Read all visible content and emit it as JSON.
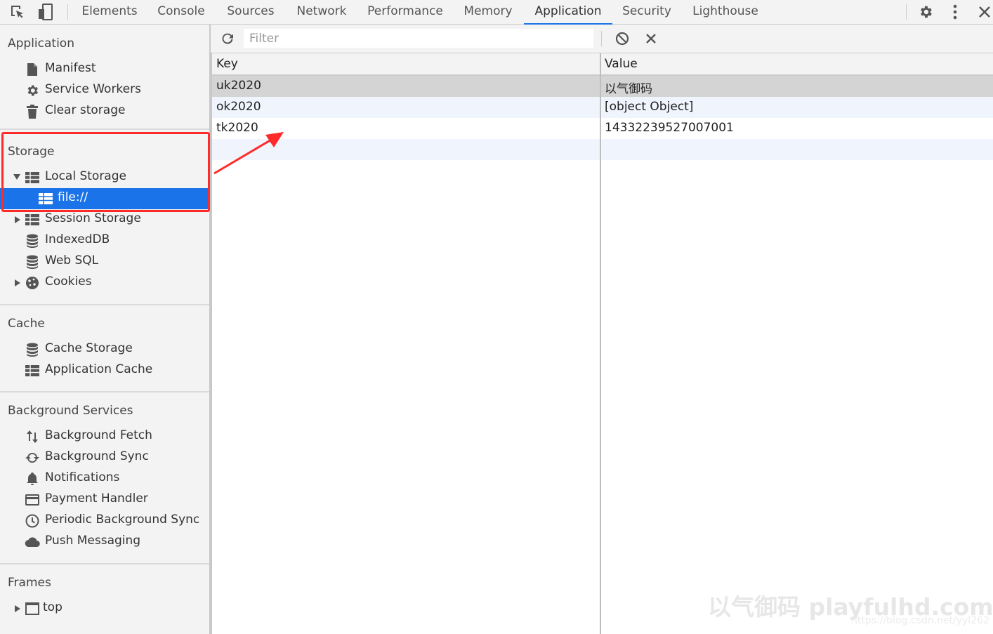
{
  "tabs": [
    "Elements",
    "Console",
    "Sources",
    "Network",
    "Performance",
    "Memory",
    "Application",
    "Security",
    "Lighthouse"
  ],
  "active_tab": "Application",
  "icons": {
    "inspect": "inspect-element-icon",
    "device": "device-toolbar-icon",
    "settings": "gear-icon",
    "more": "kebab-menu-icon",
    "close": "close-icon"
  },
  "sidebar": {
    "application": {
      "title": "Application",
      "items": [
        "Manifest",
        "Service Workers",
        "Clear storage"
      ]
    },
    "storage": {
      "title": "Storage",
      "local_storage": "Local Storage",
      "local_storage_child": "file://",
      "items": [
        "Session Storage",
        "IndexedDB",
        "Web SQL",
        "Cookies"
      ]
    },
    "cache": {
      "title": "Cache",
      "items": [
        "Cache Storage",
        "Application Cache"
      ]
    },
    "background": {
      "title": "Background Services",
      "items": [
        "Background Fetch",
        "Background Sync",
        "Notifications",
        "Payment Handler",
        "Periodic Background Sync",
        "Push Messaging"
      ]
    },
    "frames": {
      "title": "Frames",
      "items": [
        "top"
      ]
    }
  },
  "filter": {
    "placeholder": "Filter"
  },
  "table": {
    "headers": {
      "key": "Key",
      "value": "Value"
    },
    "rows": [
      {
        "key": "uk2020",
        "value": "以气御码"
      },
      {
        "key": "ok2020",
        "value": "[object Object]"
      },
      {
        "key": "tk2020",
        "value": "14332239527007001"
      }
    ]
  },
  "watermark": {
    "text": "以气御码 playfulhd.com",
    "url": "https://blog.csdn.net/yyl262"
  },
  "colors": {
    "accent": "#1a73e8",
    "annotation": "#ff2a2a"
  }
}
